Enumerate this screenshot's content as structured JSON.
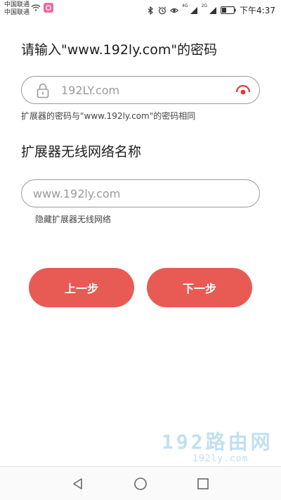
{
  "status_bar": {
    "carrier_1": "中国联通",
    "carrier_2": "中国联通",
    "net_badge_1": "4G",
    "net_badge_2": "2G",
    "time": "下午4:37"
  },
  "password_section": {
    "title": "请输入\"www.192ly.com\"的密码",
    "value": "192LY.com",
    "hint": "扩展器的密码与\"www.192ly.com\"的密码相同"
  },
  "ssid_section": {
    "title": "扩展器无线网络名称",
    "value": "www.192ly.com",
    "hint": "隐藏扩展器无线网络"
  },
  "buttons": {
    "prev": "上一步",
    "next": "下一步"
  },
  "watermark": {
    "logo": "192路由网",
    "url": "192ly.com"
  },
  "icons": [
    "wifi-icon",
    "app-notification-icon",
    "bluetooth-icon",
    "alarm-icon",
    "eye-care-icon",
    "signal-icon",
    "battery-icon",
    "lock-icon",
    "show-password-icon",
    "back-icon",
    "home-icon",
    "recents-icon"
  ],
  "colors": {
    "accent": "#e85a54",
    "watermark": "#bfe0f2"
  }
}
